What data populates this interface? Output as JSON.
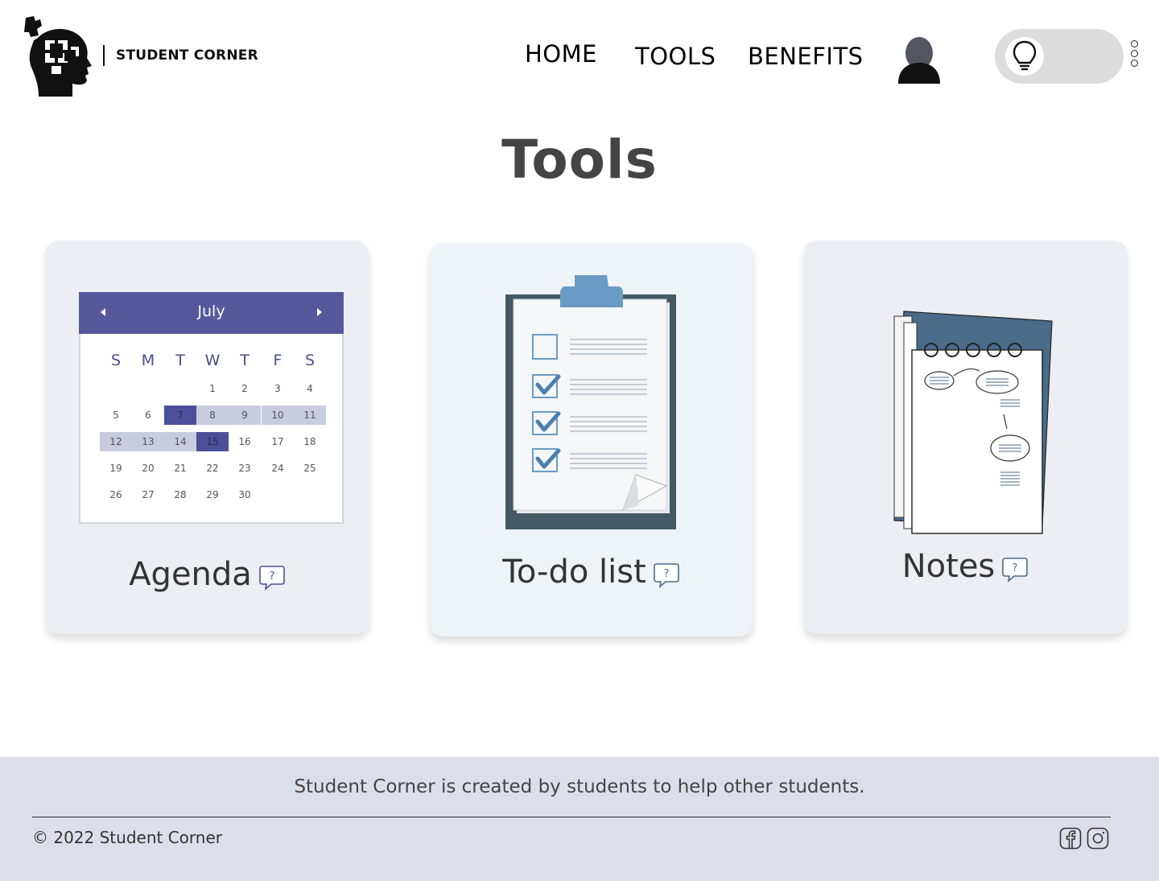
{
  "header": {
    "brand": "STUDENT CORNER",
    "nav": {
      "home": "HOME",
      "tools": "TOOLS",
      "benefits": "BENEFITS"
    }
  },
  "page": {
    "title": "Tools"
  },
  "cards": {
    "agenda": {
      "label": "Agenda"
    },
    "todo": {
      "label": "To-do list"
    },
    "notes": {
      "label": "Notes"
    }
  },
  "calendar": {
    "month": "July",
    "weekdays": [
      "S",
      "M",
      "T",
      "W",
      "T",
      "F",
      "S"
    ],
    "weeks": [
      [
        "",
        "",
        "",
        "1",
        "2",
        "3",
        "4"
      ],
      [
        "5",
        "6",
        "7",
        "8",
        "9",
        "10",
        "11"
      ],
      [
        "12",
        "13",
        "14",
        "15",
        "16",
        "17",
        "18"
      ],
      [
        "19",
        "20",
        "21",
        "22",
        "23",
        "24",
        "25"
      ],
      [
        "26",
        "27",
        "28",
        "29",
        "30",
        "",
        ""
      ]
    ],
    "selected_days": [
      "7",
      "15"
    ],
    "range_days": [
      "8",
      "9",
      "10",
      "11",
      "12",
      "13",
      "14"
    ]
  },
  "footer": {
    "tagline": "Student Corner is created by students to help other students.",
    "copyright": "© 2022 Student Corner"
  },
  "colors": {
    "calendar_header": "#55589c",
    "calendar_range": "#c9cbdf",
    "calendar_selected": "#4c4f9a",
    "footer_bg": "#dcdee9",
    "card_bg": "#eceef3",
    "clipboard_dark": "#445966",
    "clipboard_clip": "#6a9bc4",
    "notebook_cover": "#4a6b8a"
  },
  "icons": {
    "logo": "puzzle-head-logo",
    "profile": "user-avatar-icon",
    "toggle": "lightbulb-icon",
    "menu": "kebab-menu-icon",
    "help": "question-bubble-icon",
    "facebook": "facebook-icon",
    "instagram": "instagram-icon"
  }
}
